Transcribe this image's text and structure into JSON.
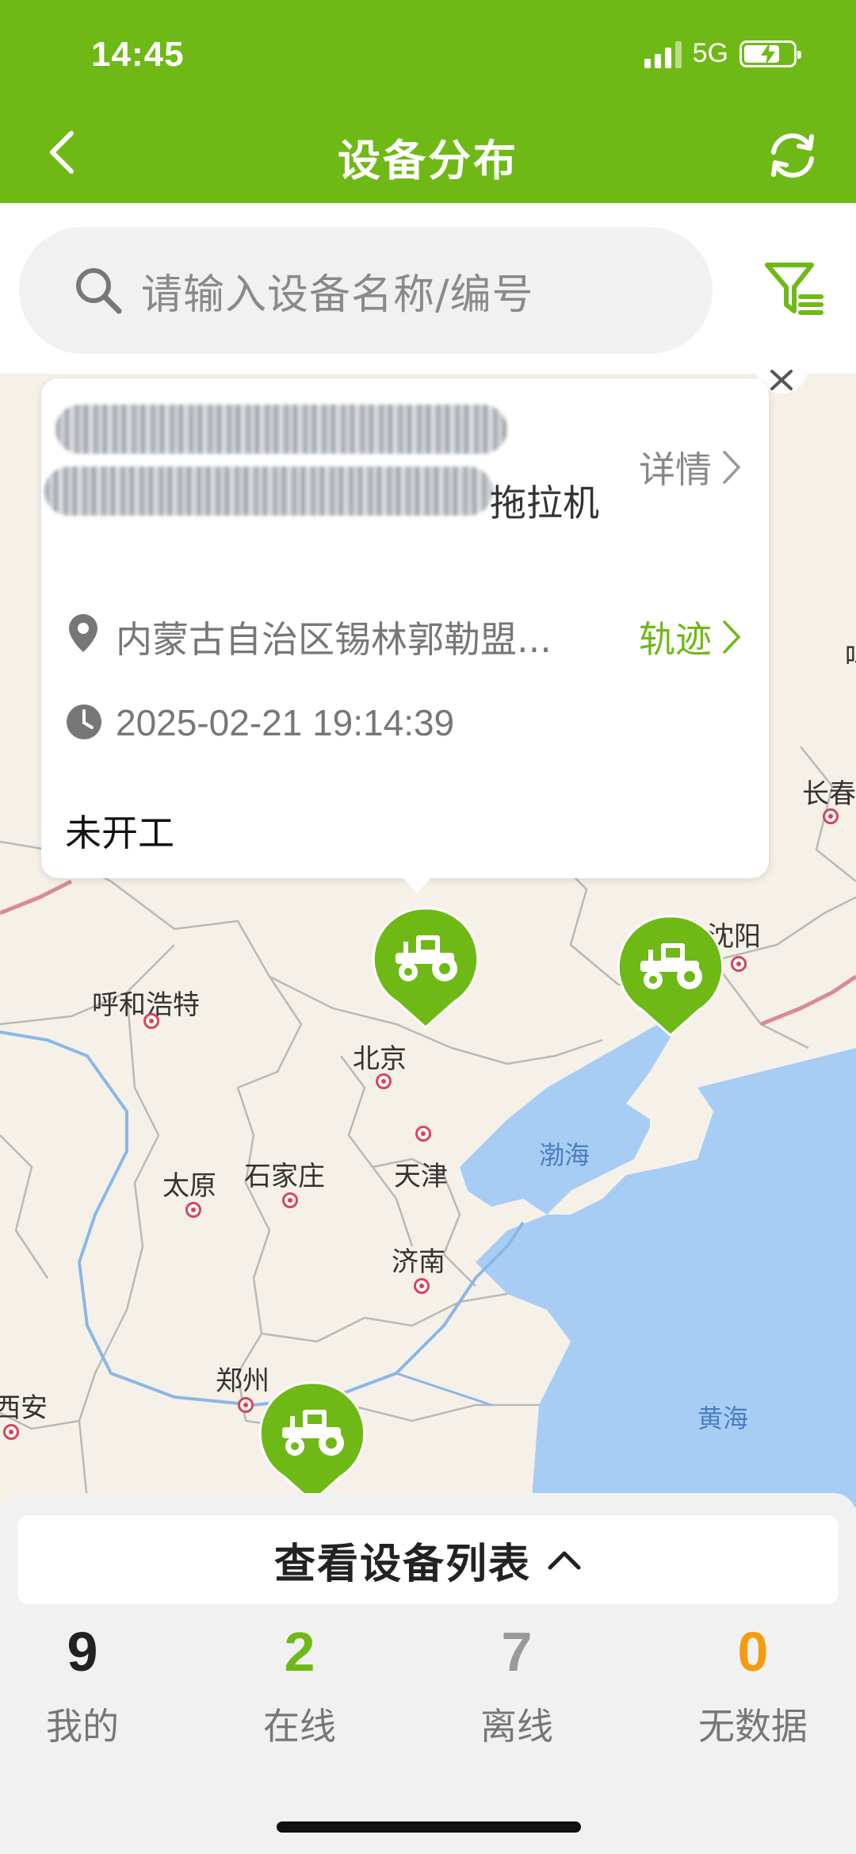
{
  "status_bar": {
    "time": "14:45",
    "network": "5G"
  },
  "nav": {
    "title": "设备分布"
  },
  "search": {
    "placeholder": "请输入设备名称/编号"
  },
  "popup": {
    "device_type": "拖拉机",
    "detail_label": "详情",
    "location": "内蒙古自治区锡林郭勒盟...",
    "track_label": "轨迹",
    "timestamp": "2025-02-21 19:14:39",
    "work_status": "未开工"
  },
  "map": {
    "cities": [
      "呼和浩特",
      "北京",
      "天津",
      "石家庄",
      "太原",
      "济南",
      "郑州",
      "西安",
      "沈阳",
      "长春"
    ],
    "seas": [
      "渤海",
      "黄海"
    ],
    "edge_fragment": "吗"
  },
  "bottom": {
    "list_button_label": "查看设备列表",
    "stats": [
      {
        "label": "我的",
        "value": "9",
        "color": "#222222"
      },
      {
        "label": "在线",
        "value": "2",
        "color": "#6fb916"
      },
      {
        "label": "离线",
        "value": "7",
        "color": "#999999"
      },
      {
        "label": "无数据",
        "value": "0",
        "color": "#f39c12"
      }
    ]
  },
  "colors": {
    "brand_green": "#6fb916",
    "sea_blue": "#a8cdf5"
  }
}
